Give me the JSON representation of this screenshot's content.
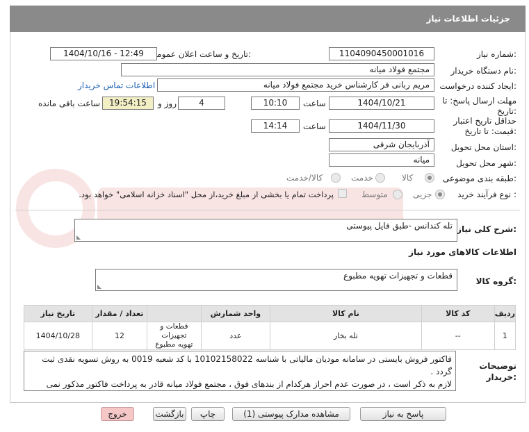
{
  "header": {
    "title": "جزئیات اطلاعات نیاز"
  },
  "form": {
    "need_number": {
      "label": "شماره نیاز:",
      "value": "1104090450001016"
    },
    "announce": {
      "label": "تاریخ و ساعت اعلان عمومی:",
      "value": "1404/10/16 - 12:49"
    },
    "buyer_org": {
      "label": "نام دستگاه خریدار:",
      "value": "مجتمع فولاد میانه"
    },
    "requester": {
      "label": "ایجاد کننده درخواست:",
      "value": "مریم ربانی فر کارشناس خرید مجتمع فولاد میانه",
      "contact_link": "اطلاعات تماس خریدار"
    },
    "deadline": {
      "label_line1": "مهلت ارسال پاسخ: تا",
      "label_line2": "تاریخ:",
      "date": "1404/10/21",
      "time_label": "ساعت",
      "time": "10:10",
      "days": "4",
      "days_label": "روز و",
      "remaining": "19:54:15",
      "remaining_label": "ساعت باقی مانده"
    },
    "price_validity": {
      "label_line1": "حداقل تاریخ اعتبار",
      "label_line2": "قیمت: تا تاریخ:",
      "date": "1404/11/30",
      "time_label": "ساعت",
      "time": "14:14"
    },
    "province": {
      "label": "استان محل تحویل:",
      "value": "آذربایجان شرقی"
    },
    "city": {
      "label": "شهر محل تحویل:",
      "value": "میانه"
    },
    "category": {
      "label": "طبقه بندی موضوعی:",
      "options": [
        "کالا",
        "خدمت",
        "کالا/خدمت"
      ],
      "selected": "کالا"
    },
    "purchase_type": {
      "label": "نوع فرآیند خرید :",
      "options": [
        "جزیی",
        "متوسط"
      ],
      "selected": "جزیی",
      "payment_note": "پرداخت تمام یا بخشی از مبلغ خرید،از محل \"اسناد خزانه اسلامی\" خواهد بود."
    }
  },
  "summary": {
    "label": "شرح کلی نیاز:",
    "value": "تله کندانس -طبق فایل پیوستی"
  },
  "goods_info_title": "اطلاعات کالاهای مورد نیاز",
  "goods_group": {
    "label": "گروه کالا:",
    "value": "قطعات و تجهیزات تهویه مطبوع"
  },
  "table": {
    "headers": [
      "ردیف",
      "کد کالا",
      "نام کالا",
      "واحد شمارش",
      "تعداد / مقدار",
      "تاریخ نیاز"
    ],
    "rows": [
      {
        "row": "1",
        "code": "--",
        "name": "تله بخار",
        "unit": "عدد",
        "qty": "12",
        "date": "1404/10/28",
        "group_line1": "قطعات و تجهیزات",
        "group_line2": "تهویه مطبوع"
      }
    ]
  },
  "buyer_notes": {
    "label_line1": "توضیحات",
    "label_line2": "خریدار:",
    "line1": "فاکتور فروش بایستی در سامانه مودیان مالیاتی با شناسه 10102158022 با کد شعبه 0019 به روش تسویه نقدی ثبت گردد .",
    "line2": "لازم به ذکر است ، در صورت عدم احراز هرکدام از بندهای فوق ، مجتمع فولاد میانه قادر به پرداخت فاکتور مذکور نمی باشد"
  },
  "buttons": {
    "reply": "پاسخ به نیاز",
    "attachments": "مشاهده مدارک پیوستی (1)",
    "print": "چاپ",
    "back": "بازگشت",
    "exit": "خروج"
  }
}
